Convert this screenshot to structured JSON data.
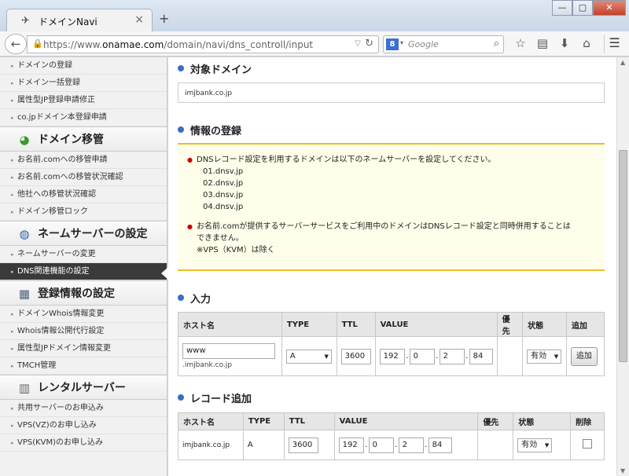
{
  "browser": {
    "tab_title": "ドメインNavi",
    "tab_close": "×",
    "new_tab": "+",
    "url_prefix": "https://www.",
    "url_domain": "onamae.com",
    "url_path": "/domain/navi/dns_controll/input",
    "search_engine_letter": "8",
    "search_placeholder": "Google",
    "win_min": "—",
    "win_max": "▢",
    "win_close": "✕"
  },
  "sidebar": {
    "top_items": [
      "ドメインの登録",
      "ドメイン一括登録",
      "属性型JP登録申請修正",
      "co.jpドメイン本登録申請"
    ],
    "sections": [
      {
        "title": "ドメイン移管",
        "icon": "transfer-icon",
        "items": [
          "お名前.comへの移管申請",
          "お名前.comへの移管状況確認",
          "他社への移管状況確認",
          "ドメイン移管ロック"
        ]
      },
      {
        "title": "ネームサーバーの設定",
        "icon": "nameserver-icon",
        "items": [
          "ネームサーバーの変更",
          "DNS関連機能の設定"
        ]
      },
      {
        "title": "登録情報の設定",
        "icon": "registration-icon",
        "items": [
          "ドメインWhois情報変更",
          "Whois情報公開代行設定",
          "属性型JPドメイン情報変更",
          "TMCH管理"
        ]
      },
      {
        "title": "レンタルサーバー",
        "icon": "server-icon",
        "items": [
          "共用サーバーのお申込み",
          "VPS(VZ)のお申し込み",
          "VPS(KVM)のお申し込み"
        ]
      }
    ],
    "active_item": "DNS関連機能の設定"
  },
  "main": {
    "target_heading": "対象ドメイン",
    "target_domain": "imjbank.co.jp",
    "info_heading": "情報の登録",
    "info_line1": "DNSレコード設定を利用するドメインは以下のネームサーバーを設定してください。",
    "nameservers": [
      "01.dnsv.jp",
      "02.dnsv.jp",
      "03.dnsv.jp",
      "04.dnsv.jp"
    ],
    "info_line2a": "お名前.comが提供するサーバーサービスをご利用中のドメインはDNSレコード設定と同時併用することは",
    "info_line2b": "できません。",
    "info_line2c": "※VPS（KVM）は除く",
    "input_heading": "入力",
    "input_table": {
      "headers": [
        "ホスト名",
        "TYPE",
        "TTL",
        "VALUE",
        "優先",
        "状態",
        "追加"
      ],
      "host_value": "www",
      "host_suffix": ".imjbank.co.jp",
      "type": "A",
      "ttl": "3600",
      "ip": [
        "192",
        "0",
        "2",
        "84"
      ],
      "status": "有効",
      "add_button": "追加"
    },
    "record_heading": "レコード追加",
    "record_table": {
      "headers": [
        "ホスト名",
        "TYPE",
        "TTL",
        "VALUE",
        "優先",
        "状態",
        "削除"
      ],
      "host": "imjbank.co.jp",
      "type": "A",
      "ttl": "3600",
      "ip": [
        "192",
        "0",
        "2",
        "84"
      ],
      "status": "有効"
    }
  }
}
